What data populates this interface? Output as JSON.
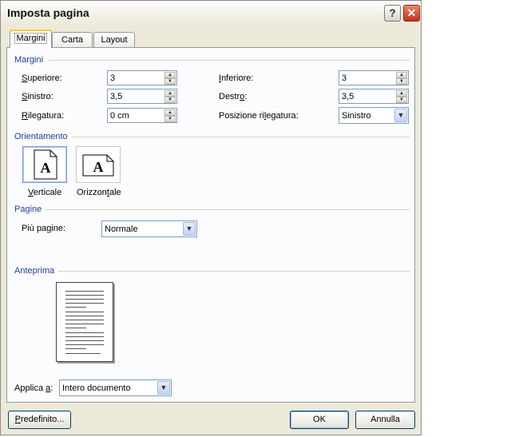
{
  "window": {
    "title": "Imposta pagina",
    "help_glyph": "?",
    "close_glyph": "✕"
  },
  "tabs": [
    {
      "label": "Margini",
      "active": true
    },
    {
      "label": "Carta",
      "active": false
    },
    {
      "label": "Layout",
      "active": false
    }
  ],
  "margini": {
    "section_label": "Margini",
    "superiore": {
      "label_first": "S",
      "label_rest": "uperiore:",
      "value": "3"
    },
    "sinistro": {
      "label_first": "S",
      "label_rest": "inistro:",
      "value": "3,5"
    },
    "rilegatura": {
      "label_first": "R",
      "label_rest": "ilegatura:",
      "value": "0 cm"
    },
    "inferiore": {
      "label_first": "I",
      "label_rest": "nferiore:",
      "value": "3"
    },
    "destro": {
      "label_pre": "Destr",
      "label_u": "o",
      "label_post": ":",
      "value": "3,5"
    },
    "posizione": {
      "label_pre": "Posizione ri",
      "label_u": "l",
      "label_post": "egatura:",
      "value": "Sinistro"
    }
  },
  "orientamento": {
    "section_label": "Orientamento",
    "glyph": "A",
    "verticale": {
      "label_first": "V",
      "label_rest": "erticale",
      "selected": true
    },
    "orizzontale": {
      "label_pre": "Orizzon",
      "label_u": "t",
      "label_post": "ale",
      "selected": false
    }
  },
  "pagine": {
    "section_label": "Pagine",
    "piu_pagine": {
      "label_pre": "Più pa",
      "label_u": "g",
      "label_post": "ine:",
      "value": "Normale"
    }
  },
  "anteprima": {
    "section_label": "Anteprima",
    "applica": {
      "label_pre": "Applica ",
      "label_u": "a",
      "label_post": ":",
      "value": "Intero documento"
    }
  },
  "buttons": {
    "predefinito": {
      "label_first": "P",
      "label_rest": "redefinito..."
    },
    "ok": "OK",
    "annulla": "Annulla"
  },
  "colors": {
    "group_label": "#1f3d9c",
    "dialog_bg": "#ece9d8",
    "tab_highlight": "#ffc73c"
  }
}
